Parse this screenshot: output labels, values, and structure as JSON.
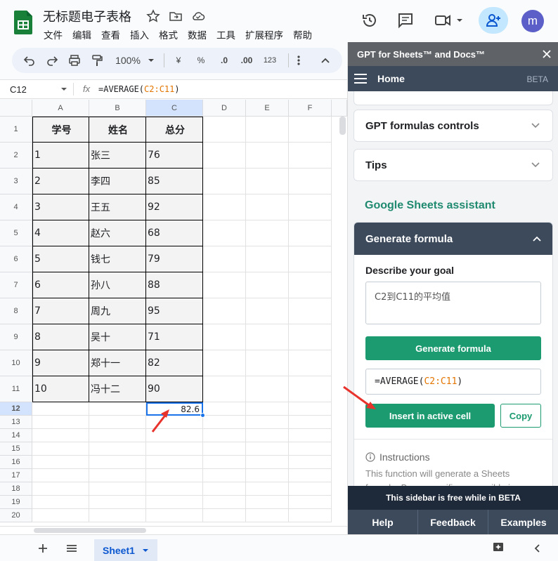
{
  "header": {
    "title": "无标题电子表格",
    "menu": [
      "文件",
      "编辑",
      "查看",
      "插入",
      "格式",
      "数据",
      "工具",
      "扩展程序",
      "帮助"
    ],
    "avatar_letter": "m"
  },
  "toolbar": {
    "zoom": "100%",
    "currency": "¥",
    "percent": "%",
    "dec_decrease": ".0",
    "dec_increase": ".00",
    "number_format": "123"
  },
  "formula_bar": {
    "name_box": "C12",
    "fx": "fx",
    "formula_prefix": "=AVERAGE(",
    "formula_range": "C2:C11",
    "formula_suffix": ")"
  },
  "grid": {
    "columns": [
      "A",
      "B",
      "C",
      "D",
      "E",
      "F"
    ],
    "rows": [
      "1",
      "2",
      "3",
      "4",
      "5",
      "6",
      "7",
      "8",
      "9",
      "10",
      "11",
      "12",
      "13",
      "14",
      "15",
      "16",
      "17",
      "18",
      "19",
      "20"
    ],
    "headers": [
      "学号",
      "姓名",
      "总分"
    ],
    "data": [
      [
        "1",
        "张三",
        "76"
      ],
      [
        "2",
        "李四",
        "85"
      ],
      [
        "3",
        "王五",
        "92"
      ],
      [
        "4",
        "赵六",
        "68"
      ],
      [
        "5",
        "钱七",
        "79"
      ],
      [
        "6",
        "孙八",
        "88"
      ],
      [
        "7",
        "周九",
        "95"
      ],
      [
        "8",
        "吴十",
        "71"
      ],
      [
        "9",
        "郑十一",
        "82"
      ],
      [
        "10",
        "冯十二",
        "90"
      ]
    ],
    "result_value": "82.6"
  },
  "sheets": {
    "active": "Sheet1"
  },
  "sidebar": {
    "title": "GPT for Sheets™ and Docs™",
    "nav_title": "Home",
    "beta": "BETA",
    "sections": [
      "GPT formulas controls",
      "Tips"
    ],
    "assistant_title": "Google Sheets assistant",
    "generate_header": "Generate formula",
    "goal_label": "Describe your goal",
    "goal_value": "C2到C11的平均值",
    "generate_button": "Generate formula",
    "result_prefix": "=AVERAGE(",
    "result_range": "C2:C11",
    "result_suffix": ")",
    "insert_button": "Insert in active cell",
    "copy_button": "Copy",
    "instructions_title": "Instructions",
    "instructions_text": "This function will generate a Sheets formula. Be as specific as possible in your",
    "free_notice": "This sidebar is free while in BETA",
    "footer": [
      "Help",
      "Feedback",
      "Examples"
    ]
  },
  "colors": {
    "accent_green": "#1c9a70",
    "sidebar_dark": "#3c4a5c",
    "selection_blue": "#1a73e8",
    "arrow_red": "#e8322c"
  }
}
